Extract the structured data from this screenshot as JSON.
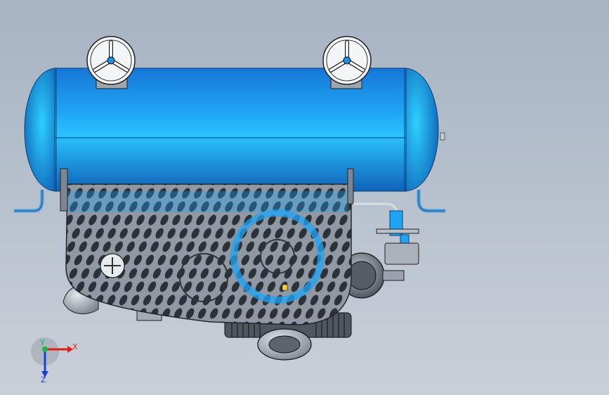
{
  "viewport": {
    "background_top": "#a7b3c3",
    "background_bottom": "#c9d0d8"
  },
  "model": {
    "tank_color": "#1a8ae6",
    "tank_highlight": "#22c6ff",
    "guard_color": "#6b7480",
    "metal_color": "#9aa3ad"
  },
  "triad": {
    "x_label": "X",
    "y_label": "Y",
    "z_label": "Z",
    "x_color": "#e21b1b",
    "y_color": "#22b14c",
    "z_color": "#1c3fd6"
  }
}
